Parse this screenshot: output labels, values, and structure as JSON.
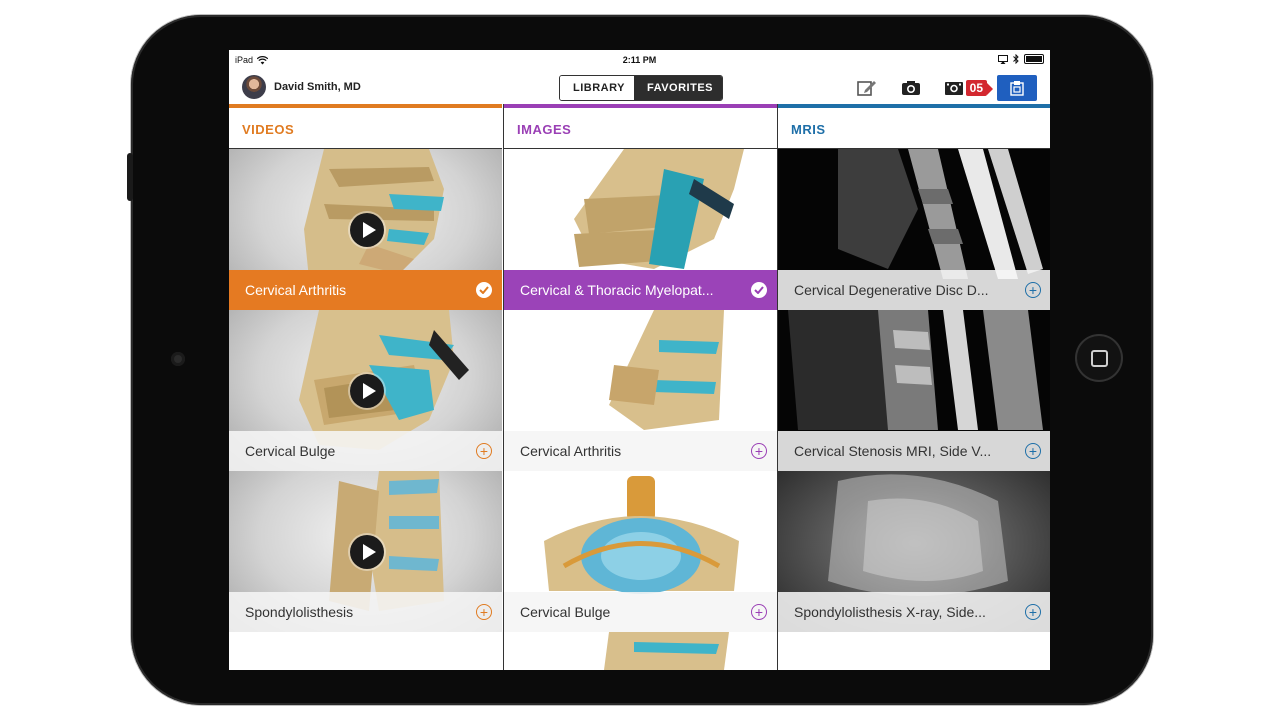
{
  "status_bar": {
    "device": "iPad",
    "time": "2:11 PM"
  },
  "user": {
    "name": "David Smith, MD"
  },
  "segmented": {
    "library": "LIBRARY",
    "favorites": "FAVORITES"
  },
  "toolbar": {
    "badge_count": "05"
  },
  "columns": {
    "videos": {
      "title": "VIDEOS",
      "items": [
        {
          "label": "Cervical Arthritis",
          "state": "selected"
        },
        {
          "label": "Cervical Bulge",
          "state": "add"
        },
        {
          "label": "Spondylolisthesis",
          "state": "add"
        }
      ]
    },
    "images": {
      "title": "IMAGES",
      "items": [
        {
          "label": "Cervical & Thoracic Myelopat...",
          "state": "selected"
        },
        {
          "label": "Cervical Arthritis",
          "state": "add"
        },
        {
          "label": "Cervical Bulge",
          "state": "add"
        }
      ]
    },
    "mris": {
      "title": "MRIS",
      "items": [
        {
          "label": "Cervical Degenerative Disc D...",
          "state": "add"
        },
        {
          "label": "Cervical Stenosis MRI, Side V...",
          "state": "add"
        },
        {
          "label": "Spondylolisthesis X-ray, Side...",
          "state": "add"
        }
      ]
    }
  },
  "colors": {
    "videos": "#e07b21",
    "images": "#9a3fb5",
    "mris": "#1e6fa8",
    "badge": "#d3272f"
  },
  "icons": [
    "wifi-icon",
    "airplay-icon",
    "bluetooth-icon",
    "battery-icon",
    "edit-icon",
    "camera-icon",
    "video-camera-icon",
    "share-icon",
    "play-icon",
    "check-icon",
    "plus-icon"
  ]
}
